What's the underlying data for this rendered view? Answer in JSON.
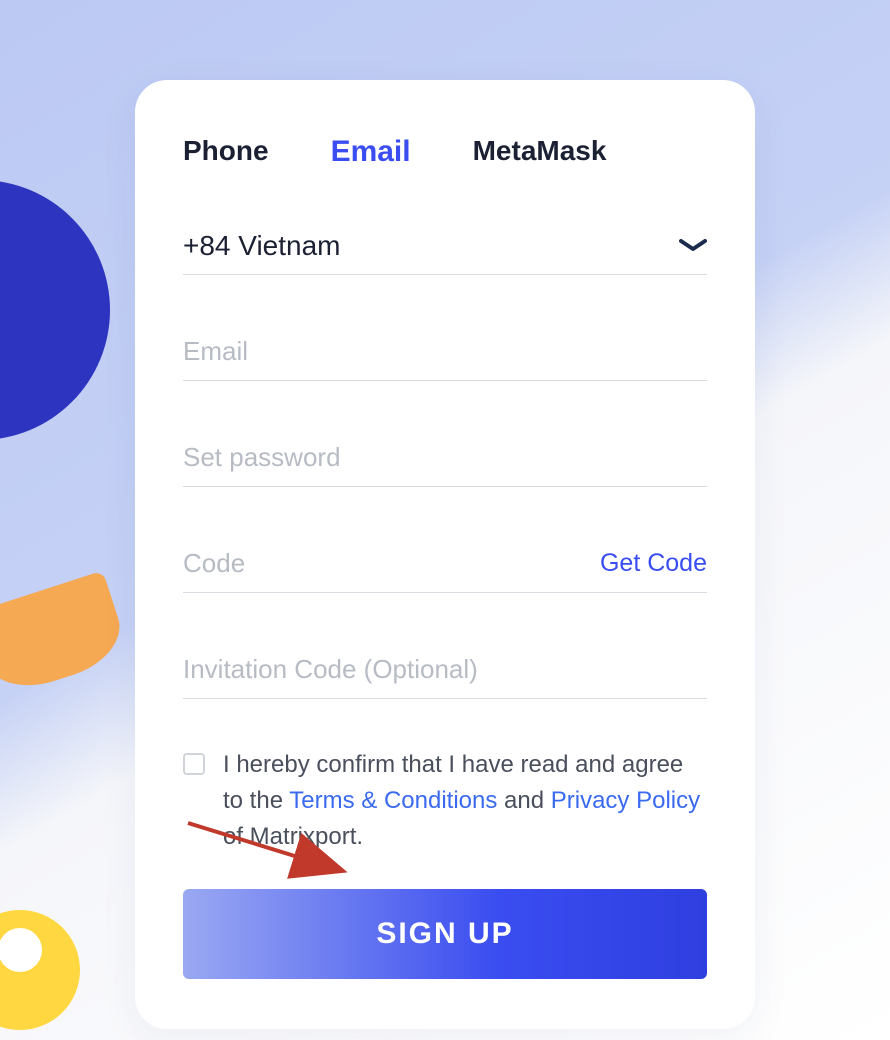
{
  "tabs": {
    "phone": "Phone",
    "email": "Email",
    "metamask": "MetaMask",
    "active": "email"
  },
  "country": {
    "selected": "+84 Vietnam"
  },
  "fields": {
    "email_placeholder": "Email",
    "password_placeholder": "Set password",
    "code_placeholder": "Code",
    "invitation_placeholder": "Invitation Code (Optional)"
  },
  "actions": {
    "get_code": "Get Code",
    "signup": "SIGN UP"
  },
  "consent": {
    "prefix": "I hereby confirm that I have read and agree to the ",
    "terms": "Terms & Conditions",
    "and": " and ",
    "privacy": "Privacy Policy",
    "suffix": " of Matrixport."
  },
  "colors": {
    "accent": "#3a4df0",
    "link": "#3a6af0"
  }
}
